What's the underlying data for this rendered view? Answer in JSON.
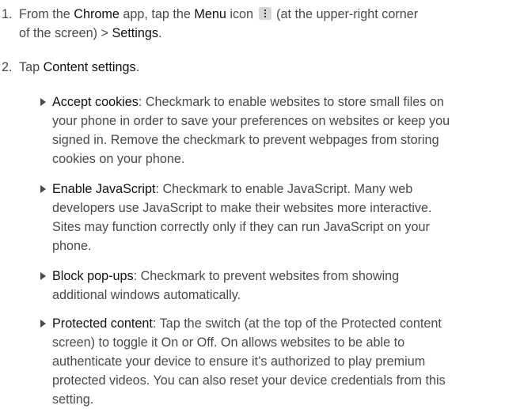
{
  "steps": [
    {
      "number": "1.",
      "parts": {
        "a": "From the ",
        "b": "Chrome",
        "c": " app, tap the ",
        "d": "Menu",
        "e": " icon ",
        "f": " (at the upper-right corner",
        "g": "of the screen) > ",
        "h": "Settings",
        "i": "."
      }
    },
    {
      "number": "2.",
      "parts": {
        "a": "Tap ",
        "b": "Content settings",
        "c": "."
      }
    }
  ],
  "bullets": [
    {
      "term": "Accept cookies",
      "lines": [
        ": Checkmark to enable websites to store small files on",
        "your phone in order to save your preferences on websites or keep you",
        "signed in. Remove the checkmark to prevent webpages from storing",
        "cookies on your phone."
      ]
    },
    {
      "term": "Enable JavaScript",
      "lines": [
        ": Checkmark to enable JavaScript. Many web",
        "developers use JavaScript to make their websites more interactive.",
        "Sites may function correctly only if they can run JavaScript on your",
        "phone."
      ]
    },
    {
      "term": "Block pop-ups",
      "lines": [
        ": Checkmark to prevent websites from showing",
        "additional windows automatically."
      ]
    },
    {
      "term": "Protected content",
      "lines": [
        ": Tap the switch (at the top of the Protected content",
        "screen) to toggle it On or Off. On allows websites to be able to",
        "authenticate your device to ensure it’s authorized to play premium",
        "protected videos. You can also reset your device credentials from this",
        "setting."
      ]
    }
  ],
  "icons": {
    "menu": "menu-icon"
  }
}
